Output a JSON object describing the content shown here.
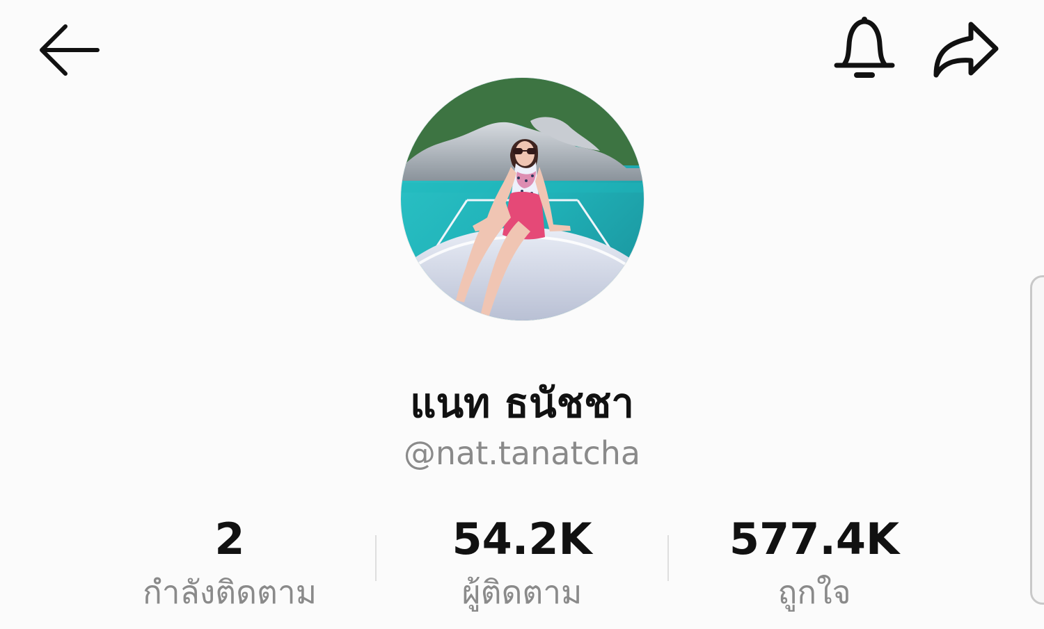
{
  "header": {
    "back_icon": "arrow-left-icon",
    "notification_icon": "bell-icon",
    "share_icon": "share-arrow-icon"
  },
  "profile": {
    "display_name": "แนท ธนัชชา",
    "username": "@nat.tanatcha"
  },
  "stats": [
    {
      "value": "2",
      "label": "กำลังติดตาม"
    },
    {
      "value": "54.2K",
      "label": "ผู้ติดตาม"
    },
    {
      "value": "577.4K",
      "label": "ถูกใจ"
    }
  ],
  "colors": {
    "background": "#fbfbfb",
    "primary_text": "#111111",
    "secondary_text": "#8a8a8a",
    "divider": "#dedede"
  }
}
